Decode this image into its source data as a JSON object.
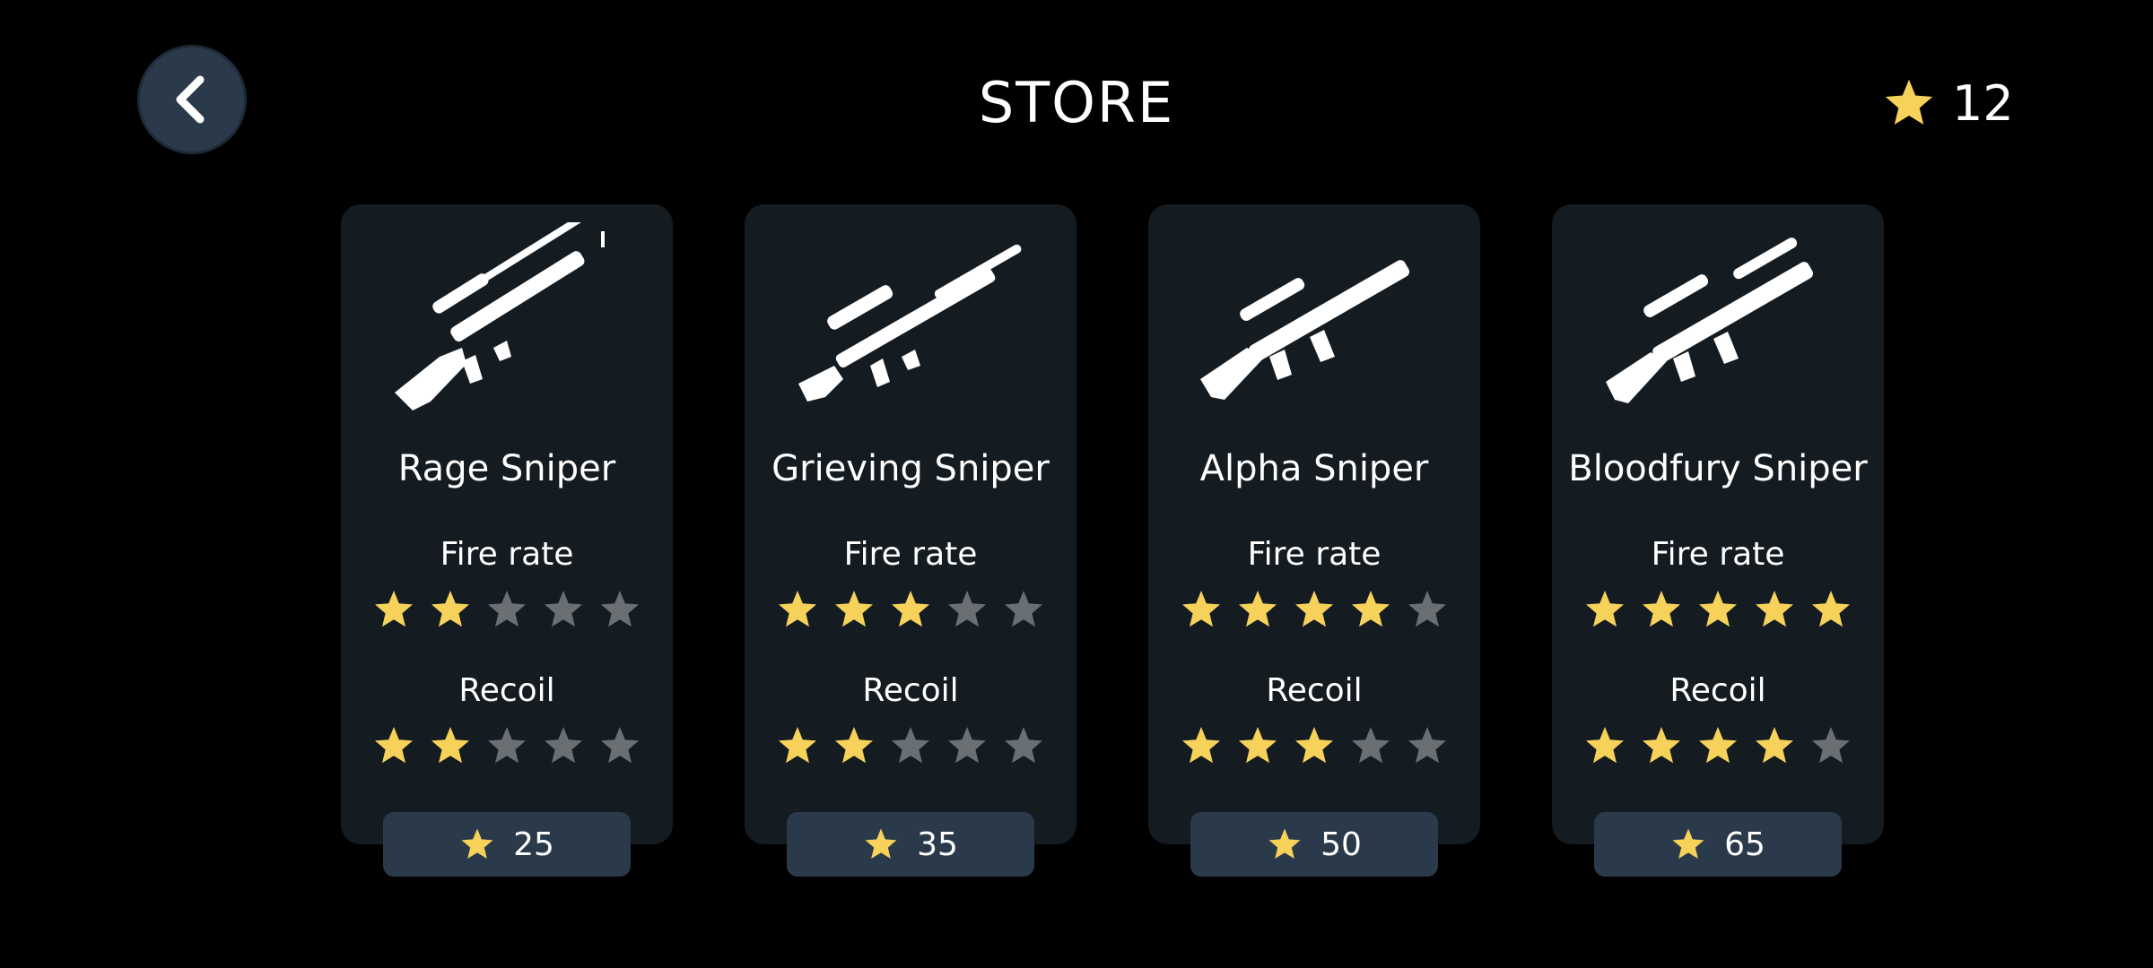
{
  "header": {
    "title": "STORE",
    "back_icon": "chevron-left-icon",
    "balance": "12",
    "currency_icon": "star-icon"
  },
  "colors": {
    "star_filled": "#f6d25b",
    "star_empty": "#6a6f73",
    "card_bg": "#141b21",
    "button_bg": "#2a3a4b"
  },
  "cards": [
    {
      "name": "Rage Sniper",
      "fire_rate_label": "Fire rate",
      "fire_rate": 2,
      "recoil_label": "Recoil",
      "recoil": 2,
      "price": "25",
      "icon": "rifle-icon"
    },
    {
      "name": "Grieving Sniper",
      "fire_rate_label": "Fire rate",
      "fire_rate": 3,
      "recoil_label": "Recoil",
      "recoil": 2,
      "price": "35",
      "icon": "rifle-icon"
    },
    {
      "name": "Alpha Sniper",
      "fire_rate_label": "Fire rate",
      "fire_rate": 4,
      "recoil_label": "Recoil",
      "recoil": 3,
      "price": "50",
      "icon": "rifle-icon"
    },
    {
      "name": "Bloodfury Sniper",
      "fire_rate_label": "Fire rate",
      "fire_rate": 5,
      "recoil_label": "Recoil",
      "recoil": 4,
      "price": "65",
      "icon": "rifle-icon"
    }
  ],
  "max_stars": 5
}
